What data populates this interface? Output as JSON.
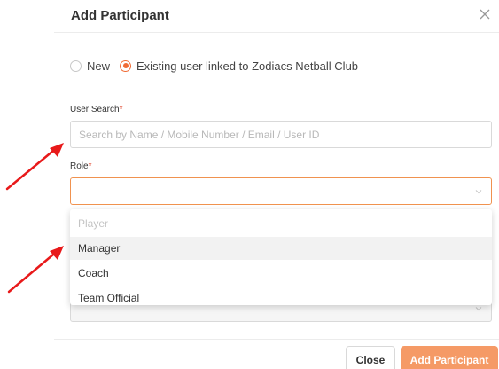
{
  "dialog": {
    "title": "Add Participant"
  },
  "participant_type": {
    "options": [
      {
        "label": "New",
        "checked": false
      },
      {
        "label": "Existing user linked to Zodiacs Netball Club",
        "checked": true
      }
    ]
  },
  "user_search": {
    "label": "User Search",
    "required_mark": "*",
    "placeholder": "Search by Name / Mobile Number / Email / User ID",
    "value": ""
  },
  "role": {
    "label": "Role",
    "required_mark": "*",
    "selected": "",
    "options": [
      {
        "label": "Player",
        "disabled": true
      },
      {
        "label": "Manager",
        "disabled": false,
        "hovered": true
      },
      {
        "label": "Coach",
        "disabled": false
      },
      {
        "label": "Team Official",
        "disabled": false
      }
    ]
  },
  "footer": {
    "close_label": "Close",
    "add_label": "Add Participant"
  },
  "colors": {
    "accent": "#f06b35",
    "primary_button": "#f59a66",
    "annotation_arrow": "#e8191a"
  },
  "icons": {
    "close": "close-icon",
    "dropdown": "chevron-down-icon",
    "annotation": "arrow-icon"
  }
}
